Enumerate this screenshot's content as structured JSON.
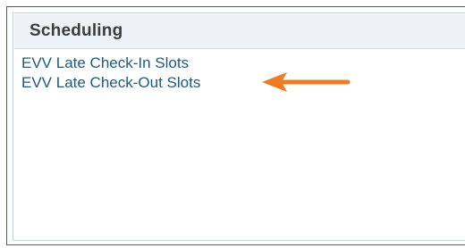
{
  "panel": {
    "title": "Scheduling",
    "links": [
      {
        "label": "EVV Late Check-In Slots"
      },
      {
        "label": "EVV Late Check-Out Slots"
      }
    ]
  },
  "annotation": {
    "icon": "left-arrow-icon",
    "color": "#f07c22"
  },
  "colors": {
    "header_bg": "#eef2f7",
    "link": "#1a5a86",
    "title": "#3d3d3d"
  }
}
